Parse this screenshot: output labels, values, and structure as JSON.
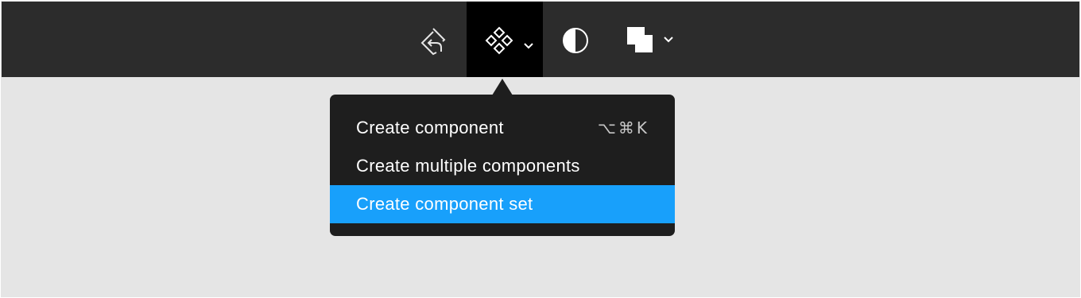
{
  "toolbar": {
    "background": "#2c2c2c",
    "active_background": "#000000",
    "tools": [
      {
        "name": "Detach / reset instance",
        "icon": "detach-instance-icon"
      },
      {
        "name": "Create component",
        "icon": "component-icon",
        "active": true,
        "has_dropdown": true
      },
      {
        "name": "Mask",
        "icon": "mask-icon"
      },
      {
        "name": "Boolean operations",
        "icon": "boolean-union-icon",
        "has_dropdown": true
      }
    ]
  },
  "menu": {
    "background": "#1e1e1e",
    "selected_color": "#18a0fb",
    "items": [
      {
        "label": "Create component",
        "shortcut": "⌥⌘K",
        "selected": false
      },
      {
        "label": "Create multiple components",
        "shortcut": "",
        "selected": false
      },
      {
        "label": "Create component set",
        "shortcut": "",
        "selected": true
      }
    ]
  },
  "canvas": {
    "background": "#e5e5e5"
  }
}
